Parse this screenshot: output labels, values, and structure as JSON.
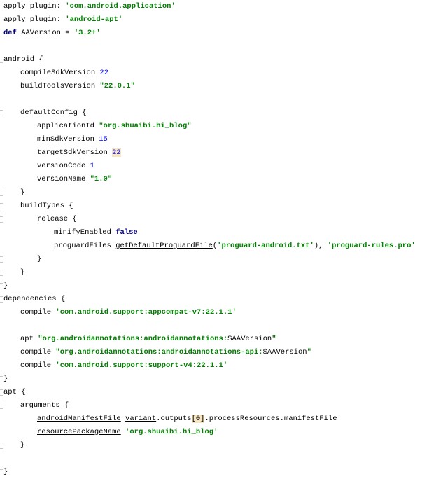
{
  "editor": {
    "lines": [
      {
        "indent": 0,
        "tokens": [
          {
            "t": "apply plugin: ",
            "c": ""
          },
          {
            "t": "'com.android.application'",
            "c": "str"
          }
        ]
      },
      {
        "indent": 0,
        "tokens": [
          {
            "t": "apply plugin: ",
            "c": ""
          },
          {
            "t": "'android-apt'",
            "c": "str"
          }
        ]
      },
      {
        "indent": 0,
        "tokens": [
          {
            "t": "def",
            "c": "kw"
          },
          {
            "t": " AAVersion = ",
            "c": ""
          },
          {
            "t": "'3.2+'",
            "c": "str"
          }
        ]
      },
      {
        "indent": 0,
        "tokens": []
      },
      {
        "indent": 0,
        "fold": true,
        "tokens": [
          {
            "t": "android {",
            "c": ""
          }
        ]
      },
      {
        "indent": 1,
        "tokens": [
          {
            "t": "compileSdkVersion ",
            "c": ""
          },
          {
            "t": "22",
            "c": "num"
          }
        ]
      },
      {
        "indent": 1,
        "tokens": [
          {
            "t": "buildToolsVersion ",
            "c": ""
          },
          {
            "t": "\"22.0.1\"",
            "c": "str"
          }
        ]
      },
      {
        "indent": 0,
        "tokens": []
      },
      {
        "indent": 1,
        "fold": true,
        "tokens": [
          {
            "t": "defaultConfig {",
            "c": ""
          }
        ]
      },
      {
        "indent": 2,
        "tokens": [
          {
            "t": "applicationId ",
            "c": ""
          },
          {
            "t": "\"org.shuaibi.hi_blog\"",
            "c": "str"
          }
        ]
      },
      {
        "indent": 2,
        "tokens": [
          {
            "t": "minSdkVersion ",
            "c": ""
          },
          {
            "t": "15",
            "c": "num"
          }
        ]
      },
      {
        "indent": 2,
        "tokens": [
          {
            "t": "targetSdkVersion ",
            "c": ""
          },
          {
            "t": "22",
            "c": "num hl"
          }
        ]
      },
      {
        "indent": 2,
        "tokens": [
          {
            "t": "versionCode ",
            "c": ""
          },
          {
            "t": "1",
            "c": "num"
          }
        ]
      },
      {
        "indent": 2,
        "tokens": [
          {
            "t": "versionName ",
            "c": ""
          },
          {
            "t": "\"1.0\"",
            "c": "str"
          }
        ]
      },
      {
        "indent": 1,
        "fold": true,
        "tokens": [
          {
            "t": "}",
            "c": ""
          }
        ]
      },
      {
        "indent": 1,
        "fold": true,
        "tokens": [
          {
            "t": "buildTypes {",
            "c": ""
          }
        ]
      },
      {
        "indent": 2,
        "fold": true,
        "tokens": [
          {
            "t": "release {",
            "c": ""
          }
        ]
      },
      {
        "indent": 3,
        "tokens": [
          {
            "t": "minifyEnabled ",
            "c": ""
          },
          {
            "t": "false",
            "c": "kw"
          }
        ]
      },
      {
        "indent": 3,
        "tokens": [
          {
            "t": "proguardFiles ",
            "c": ""
          },
          {
            "t": "getDefaultProguardFile",
            "c": "ul"
          },
          {
            "t": "(",
            "c": ""
          },
          {
            "t": "'proguard-android.txt'",
            "c": "str"
          },
          {
            "t": "), ",
            "c": ""
          },
          {
            "t": "'proguard-rules.pro'",
            "c": "str"
          }
        ]
      },
      {
        "indent": 2,
        "fold": true,
        "tokens": [
          {
            "t": "}",
            "c": ""
          }
        ]
      },
      {
        "indent": 1,
        "fold": true,
        "tokens": [
          {
            "t": "}",
            "c": ""
          }
        ]
      },
      {
        "indent": 0,
        "fold": true,
        "tokens": [
          {
            "t": "}",
            "c": ""
          }
        ]
      },
      {
        "indent": 0,
        "fold": true,
        "tokens": [
          {
            "t": "dependencies {",
            "c": ""
          }
        ]
      },
      {
        "indent": 1,
        "tokens": [
          {
            "t": "compile ",
            "c": ""
          },
          {
            "t": "'com.android.support:appcompat-v7:22.1.1'",
            "c": "str"
          }
        ]
      },
      {
        "indent": 0,
        "tokens": []
      },
      {
        "indent": 1,
        "tokens": [
          {
            "t": "apt ",
            "c": ""
          },
          {
            "t": "\"org.androidannotations:androidannotations:",
            "c": "str"
          },
          {
            "t": "$AAVersion",
            "c": ""
          },
          {
            "t": "\"",
            "c": "str"
          }
        ]
      },
      {
        "indent": 1,
        "tokens": [
          {
            "t": "compile ",
            "c": ""
          },
          {
            "t": "\"org.androidannotations:androidannotations-api:",
            "c": "str"
          },
          {
            "t": "$AAVersion",
            "c": ""
          },
          {
            "t": "\"",
            "c": "str"
          }
        ]
      },
      {
        "indent": 1,
        "tokens": [
          {
            "t": "compile ",
            "c": ""
          },
          {
            "t": "'com.android.support:support-v4:22.1.1'",
            "c": "str"
          }
        ]
      },
      {
        "indent": 0,
        "fold": true,
        "tokens": [
          {
            "t": "}",
            "c": ""
          }
        ]
      },
      {
        "indent": 0,
        "fold": true,
        "tokens": [
          {
            "t": "apt {",
            "c": ""
          }
        ]
      },
      {
        "indent": 1,
        "fold": true,
        "tokens": [
          {
            "t": "arguments",
            "c": "ul"
          },
          {
            "t": " {",
            "c": ""
          }
        ]
      },
      {
        "indent": 2,
        "tokens": [
          {
            "t": "androidManifestFile",
            "c": "ul"
          },
          {
            "t": " ",
            "c": ""
          },
          {
            "t": "variant",
            "c": "ul"
          },
          {
            "t": ".outputs",
            "c": ""
          },
          {
            "t": "[0]",
            "c": "hl"
          },
          {
            "t": ".processResources.manifestFile",
            "c": ""
          }
        ]
      },
      {
        "indent": 2,
        "tokens": [
          {
            "t": "resourcePackageName",
            "c": "ul"
          },
          {
            "t": " ",
            "c": ""
          },
          {
            "t": "'org.shuaibi.hi_blog'",
            "c": "str"
          }
        ]
      },
      {
        "indent": 1,
        "fold": true,
        "tokens": [
          {
            "t": "}",
            "c": ""
          }
        ]
      },
      {
        "indent": 0,
        "tokens": []
      },
      {
        "indent": 0,
        "fold": true,
        "tokens": [
          {
            "t": "}",
            "c": ""
          }
        ]
      }
    ]
  }
}
